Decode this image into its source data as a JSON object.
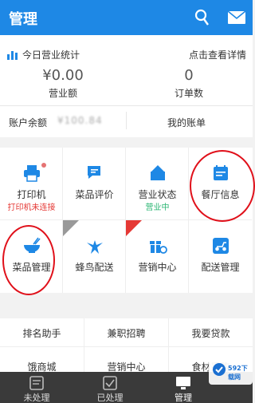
{
  "header": {
    "title": "管理"
  },
  "stats": {
    "title": "今日营业统计",
    "detail_link": "点击查看详情",
    "revenue_value": "¥0.00",
    "revenue_label": "营业额",
    "orders_value": "0",
    "orders_label": "订单数",
    "balance_label": "账户余额",
    "balance_value": "¥100.84",
    "account_link": "我的账单"
  },
  "grid": [
    {
      "label": "打印机",
      "sub": "打印机未连接"
    },
    {
      "label": "菜品评价"
    },
    {
      "label": "营业状态",
      "sub": "营业中"
    },
    {
      "label": "餐厅信息"
    },
    {
      "label": "菜品管理"
    },
    {
      "label": "蜂鸟配送"
    },
    {
      "label": "营销中心"
    },
    {
      "label": "配送管理"
    }
  ],
  "links": [
    "排名助手",
    "兼职招聘",
    "我要贷款",
    "饿商城",
    "营销中心",
    "食材采购"
  ],
  "tabs": [
    "未处理",
    "已处理",
    "管理"
  ],
  "watermark": {
    "text": "592下载网"
  },
  "colors": {
    "brand": "#1e88e5",
    "highlight_circle": "#e0101a",
    "warning": "#e53935",
    "ok": "#2bb673"
  }
}
